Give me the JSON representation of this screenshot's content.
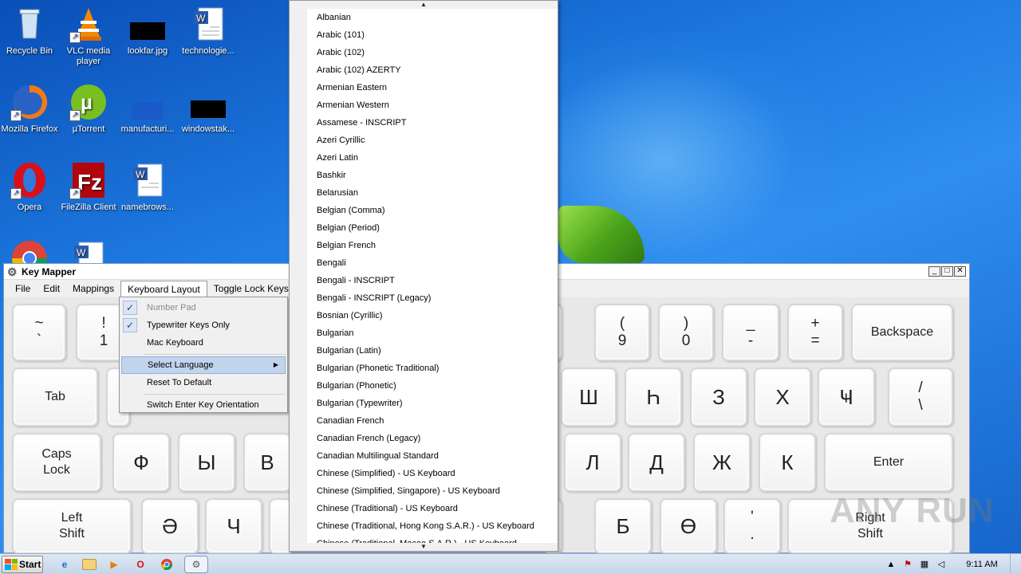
{
  "desktop": {
    "icons": [
      {
        "label": "Recycle Bin"
      },
      {
        "label": "VLC media player"
      },
      {
        "label": "lookfar.jpg"
      },
      {
        "label": "technologie..."
      },
      {
        "label": "Mozilla Firefox"
      },
      {
        "label": "µTorrent"
      },
      {
        "label": "manufacturi..."
      },
      {
        "label": "windowstak..."
      },
      {
        "label": "Opera"
      },
      {
        "label": "FileZilla Client"
      },
      {
        "label": "namebrows..."
      }
    ],
    "watermark": "ANY RUN"
  },
  "window": {
    "title": "Key Mapper",
    "controls": {
      "minimize": "_",
      "maximize": "□",
      "close": "✕"
    },
    "menu": [
      "File",
      "Edit",
      "Mappings",
      "Keyboard Layout",
      "Toggle Lock Keys"
    ]
  },
  "keyboard_layout_menu": {
    "items": [
      {
        "label": "Number Pad",
        "checked": true,
        "disabled": true
      },
      {
        "label": "Typewriter Keys Only",
        "checked": true
      },
      {
        "label": "Mac Keyboard"
      },
      {
        "label": "Select Language",
        "highlighted": true,
        "submenu": true
      },
      {
        "label": "Reset To Default"
      },
      {
        "label": "Switch Enter Key Orientation"
      }
    ],
    "check_glyph": "✓",
    "submenu_arrow": "▶"
  },
  "language_list": {
    "scroll_up": "▲",
    "scroll_down": "▼",
    "items": [
      "Albanian",
      "Arabic (101)",
      "Arabic (102)",
      "Arabic (102) AZERTY",
      "Armenian Eastern",
      "Armenian Western",
      "Assamese - INSCRIPT",
      "Azeri Cyrillic",
      "Azeri Latin",
      "Bashkir",
      "Belarusian",
      "Belgian (Comma)",
      "Belgian (Period)",
      "Belgian French",
      "Bengali",
      "Bengali - INSCRIPT",
      "Bengali - INSCRIPT (Legacy)",
      "Bosnian (Cyrillic)",
      "Bulgarian",
      "Bulgarian (Latin)",
      "Bulgarian (Phonetic Traditional)",
      "Bulgarian (Phonetic)",
      "Bulgarian (Typewriter)",
      "Canadian French",
      "Canadian French (Legacy)",
      "Canadian Multilingual Standard",
      "Chinese (Simplified) - US Keyboard",
      "Chinese (Simplified, Singapore) - US Keyboard",
      "Chinese (Traditional) - US Keyboard",
      "Chinese (Traditional, Hong Kong S.A.R.) - US Keyboard",
      "Chinese (Traditional, Macao S.A.R.) - US Keyboard"
    ]
  },
  "keys": {
    "tilde": {
      "top": "~",
      "bottom": "`"
    },
    "one": {
      "top": "!",
      "bottom": "1"
    },
    "nine": {
      "top": "(",
      "bottom": "9"
    },
    "zero": {
      "top": ")",
      "bottom": "0"
    },
    "minus": {
      "top": "_",
      "bottom": "-"
    },
    "equals": {
      "top": "+",
      "bottom": "="
    },
    "backspace": "Backspace",
    "tab": "Tab",
    "row2": [
      "Ш",
      "Һ",
      "З",
      "Х",
      "Ҹ"
    ],
    "slash": {
      "top": "/",
      "bottom": "\\"
    },
    "caps": {
      "top": "Caps",
      "bottom": "Lock"
    },
    "row3_left": [
      "Ф",
      "Ы",
      "В"
    ],
    "row3_right": [
      "Л",
      "Д",
      "Ж",
      "К"
    ],
    "enter": "Enter",
    "lshift": {
      "top": "Left",
      "bottom": "Shift"
    },
    "row4_left": [
      "Ә",
      "Ч"
    ],
    "row4_right": [
      "Б",
      "Ө"
    ],
    "row4_partial": "т",
    "row1_partial": "8",
    "comma": {
      "top": "'",
      "bottom": "."
    },
    "rshift": {
      "top": "Right",
      "bottom": "Shift"
    }
  },
  "taskbar": {
    "start": "Start",
    "clock": "9:11 AM"
  }
}
